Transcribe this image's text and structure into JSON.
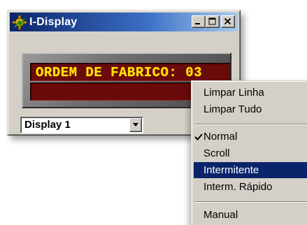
{
  "window": {
    "title": "I-Display",
    "app_icon": "gear-app-icon",
    "caption_buttons": {
      "minimize_icon": "minimize-icon",
      "maximize_icon": "maximize-icon",
      "close_icon": "close-icon"
    }
  },
  "led_display": {
    "line1": "ORDEM DE FABRICO: 03",
    "line2": "",
    "text_color": "#ffe600",
    "background_color": "#6b0a0a"
  },
  "display_selector": {
    "value": "Display 1",
    "dropdown_icon": "chevron-down-icon"
  },
  "context_menu": {
    "items": [
      {
        "label": "Limpar Linha",
        "checked": false,
        "highlighted": false
      },
      {
        "label": "Limpar Tudo",
        "checked": false,
        "highlighted": false
      },
      {
        "label": "Normal",
        "checked": true,
        "highlighted": false
      },
      {
        "label": "Scroll",
        "checked": false,
        "highlighted": false
      },
      {
        "label": "Intermitente",
        "checked": false,
        "highlighted": true
      },
      {
        "label": "Interm. Rápido",
        "checked": false,
        "highlighted": false
      },
      {
        "label": "Manual",
        "checked": false,
        "highlighted": false
      }
    ],
    "check_icon": "checkmark-icon"
  },
  "colors": {
    "title_bar_start": "#0a246a",
    "title_bar_end": "#a6caf0",
    "face": "#d4d0c8",
    "highlight": "#0a246a"
  }
}
